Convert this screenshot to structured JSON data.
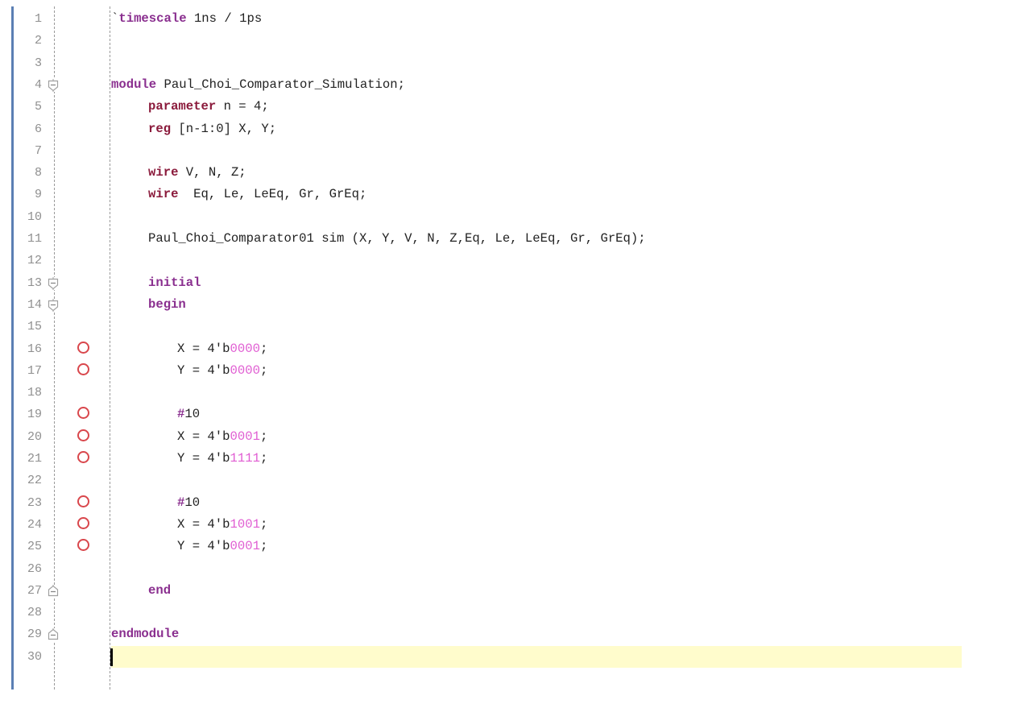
{
  "editor": {
    "language": "Verilog",
    "current_line": 30,
    "lines": [
      {
        "n": "1",
        "fold": "",
        "bp": false,
        "indent": 0,
        "tokens": [
          {
            "t": "`",
            "c": "plain"
          },
          {
            "t": "timescale",
            "c": "kw"
          },
          {
            "t": " 1ns / 1ps",
            "c": "plain"
          }
        ]
      },
      {
        "n": "2",
        "fold": "",
        "bp": false,
        "indent": 0,
        "tokens": []
      },
      {
        "n": "3",
        "fold": "",
        "bp": false,
        "indent": 0,
        "tokens": []
      },
      {
        "n": "4",
        "fold": "open",
        "bp": false,
        "indent": 0,
        "tokens": [
          {
            "t": "module",
            "c": "kw"
          },
          {
            "t": " Paul_Choi_Comparator_Simulation;",
            "c": "plain"
          }
        ]
      },
      {
        "n": "5",
        "fold": "",
        "bp": false,
        "indent": 1,
        "tokens": [
          {
            "t": "parameter",
            "c": "kw2"
          },
          {
            "t": " n = 4;",
            "c": "plain"
          }
        ]
      },
      {
        "n": "6",
        "fold": "",
        "bp": false,
        "indent": 1,
        "tokens": [
          {
            "t": "reg",
            "c": "kw2"
          },
          {
            "t": " [n-1:0] X, Y;",
            "c": "plain"
          }
        ]
      },
      {
        "n": "7",
        "fold": "",
        "bp": false,
        "indent": 0,
        "tokens": []
      },
      {
        "n": "8",
        "fold": "",
        "bp": false,
        "indent": 1,
        "tokens": [
          {
            "t": "wire",
            "c": "kw2"
          },
          {
            "t": " V, N, Z;",
            "c": "plain"
          }
        ]
      },
      {
        "n": "9",
        "fold": "",
        "bp": false,
        "indent": 1,
        "tokens": [
          {
            "t": "wire",
            "c": "kw2"
          },
          {
            "t": "  Eq, Le, LeEq, Gr, GrEq;",
            "c": "plain"
          }
        ]
      },
      {
        "n": "10",
        "fold": "",
        "bp": false,
        "indent": 0,
        "tokens": []
      },
      {
        "n": "11",
        "fold": "",
        "bp": false,
        "indent": 1,
        "tokens": [
          {
            "t": "Paul_Choi_Comparator01 sim (X, Y, V, N, Z,Eq, Le, LeEq, Gr, GrEq);",
            "c": "plain"
          }
        ]
      },
      {
        "n": "12",
        "fold": "",
        "bp": false,
        "indent": 0,
        "tokens": []
      },
      {
        "n": "13",
        "fold": "open",
        "bp": false,
        "indent": 1,
        "tokens": [
          {
            "t": "initial",
            "c": "kw"
          }
        ]
      },
      {
        "n": "14",
        "fold": "open",
        "bp": false,
        "indent": 1,
        "tokens": [
          {
            "t": "begin",
            "c": "kw"
          }
        ]
      },
      {
        "n": "15",
        "fold": "",
        "bp": false,
        "indent": 0,
        "tokens": []
      },
      {
        "n": "16",
        "fold": "",
        "bp": true,
        "indent": 2,
        "tokens": [
          {
            "t": "X = 4'b",
            "c": "plain"
          },
          {
            "t": "0000",
            "c": "num"
          },
          {
            "t": ";",
            "c": "plain"
          }
        ]
      },
      {
        "n": "17",
        "fold": "",
        "bp": true,
        "indent": 2,
        "tokens": [
          {
            "t": "Y = 4'b",
            "c": "plain"
          },
          {
            "t": "0000",
            "c": "num"
          },
          {
            "t": ";",
            "c": "plain"
          }
        ]
      },
      {
        "n": "18",
        "fold": "",
        "bp": false,
        "indent": 0,
        "tokens": []
      },
      {
        "n": "19",
        "fold": "",
        "bp": true,
        "indent": 2,
        "tokens": [
          {
            "t": "#",
            "c": "kw"
          },
          {
            "t": "10",
            "c": "plain"
          }
        ]
      },
      {
        "n": "20",
        "fold": "",
        "bp": true,
        "indent": 2,
        "tokens": [
          {
            "t": "X = 4'b",
            "c": "plain"
          },
          {
            "t": "0001",
            "c": "num"
          },
          {
            "t": ";",
            "c": "plain"
          }
        ]
      },
      {
        "n": "21",
        "fold": "",
        "bp": true,
        "indent": 2,
        "tokens": [
          {
            "t": "Y = 4'b",
            "c": "plain"
          },
          {
            "t": "1111",
            "c": "num"
          },
          {
            "t": ";",
            "c": "plain"
          }
        ]
      },
      {
        "n": "22",
        "fold": "",
        "bp": false,
        "indent": 0,
        "tokens": []
      },
      {
        "n": "23",
        "fold": "",
        "bp": true,
        "indent": 2,
        "tokens": [
          {
            "t": "#",
            "c": "kw"
          },
          {
            "t": "10",
            "c": "plain"
          }
        ]
      },
      {
        "n": "24",
        "fold": "",
        "bp": true,
        "indent": 2,
        "tokens": [
          {
            "t": "X = 4'b",
            "c": "plain"
          },
          {
            "t": "1001",
            "c": "num"
          },
          {
            "t": ";",
            "c": "plain"
          }
        ]
      },
      {
        "n": "25",
        "fold": "",
        "bp": true,
        "indent": 2,
        "tokens": [
          {
            "t": "Y = 4'b",
            "c": "plain"
          },
          {
            "t": "0001",
            "c": "num"
          },
          {
            "t": ";",
            "c": "plain"
          }
        ]
      },
      {
        "n": "26",
        "fold": "",
        "bp": false,
        "indent": 0,
        "tokens": []
      },
      {
        "n": "27",
        "fold": "close",
        "bp": false,
        "indent": 1,
        "tokens": [
          {
            "t": "end",
            "c": "kw"
          }
        ]
      },
      {
        "n": "28",
        "fold": "",
        "bp": false,
        "indent": 0,
        "tokens": []
      },
      {
        "n": "29",
        "fold": "close",
        "bp": false,
        "indent": 0,
        "tokens": [
          {
            "t": "endmodule",
            "c": "kw"
          }
        ]
      },
      {
        "n": "30",
        "fold": "",
        "bp": false,
        "indent": 0,
        "tokens": []
      }
    ]
  },
  "colors": {
    "keyword_purple": "#8a2f8f",
    "keyword_maroon": "#8b1b3c",
    "number_pink": "#e05cd2",
    "breakpoint_red": "#d9474c",
    "current_line_bg": "#fffccc",
    "gutter_bar": "#5b7fb4"
  }
}
